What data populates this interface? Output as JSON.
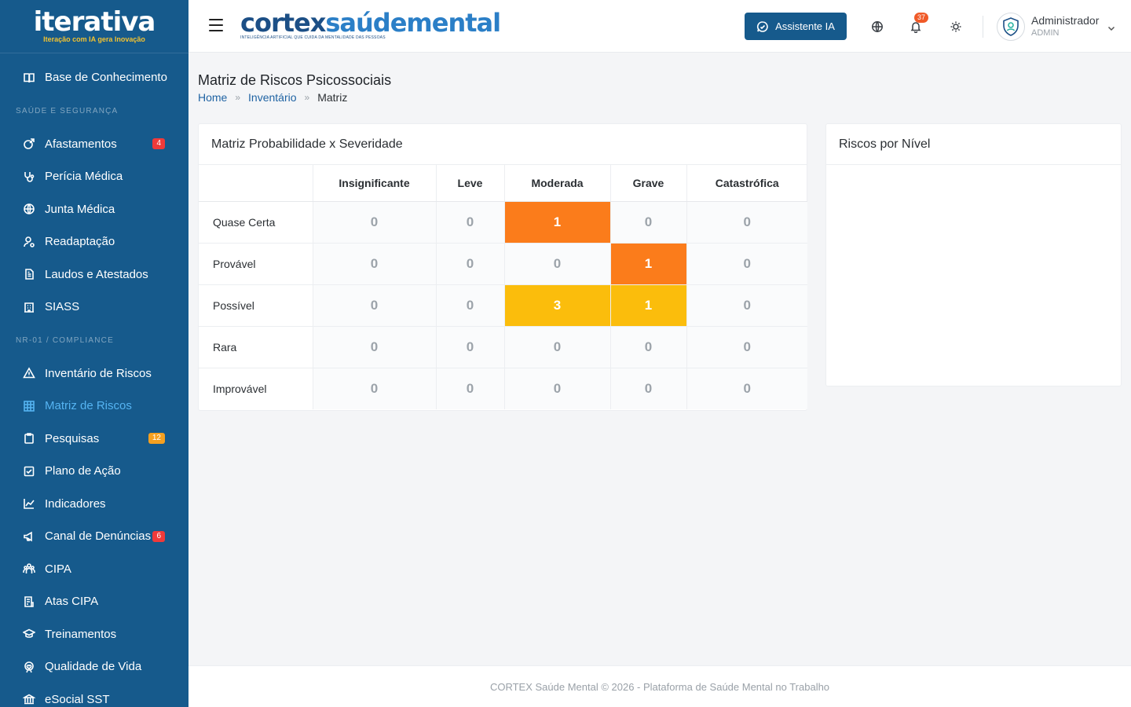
{
  "brand": {
    "name": "iterativa",
    "tagline": "Iteração com IA gera Inovação"
  },
  "header": {
    "logo_part1": "cortex",
    "logo_part2": "saúdemental",
    "logo_sub": "INTELIGÊNCIA ARTIFICIAL QUE CUIDA DA MENTALIDADE DAS PESSOAS",
    "ai_button": "Assistente IA",
    "notifications_count": "37",
    "user_name": "Administrador",
    "user_role": "ADMIN",
    "icons": {
      "menu": "hamburger-icon",
      "language": "globe-icon",
      "notifications": "bell-icon",
      "theme": "sun-icon"
    }
  },
  "sidebar": {
    "top_item": {
      "label": "Base de Conhecimento",
      "icon": "book-icon"
    },
    "section1": "SAÚDE E SEGURANÇA",
    "items1": [
      {
        "label": "Afastamentos",
        "icon": "leave-icon",
        "badge": "4",
        "badge_color": "#f03a3a"
      },
      {
        "label": "Perícia Médica",
        "icon": "stethoscope-icon"
      },
      {
        "label": "Junta Médica",
        "icon": "globe-icon"
      },
      {
        "label": "Readaptação",
        "icon": "user-cog-icon"
      },
      {
        "label": "Laudos e Atestados",
        "icon": "document-icon"
      },
      {
        "label": "SIASS",
        "icon": "building-icon"
      }
    ],
    "section2": "NR-01 / COMPLIANCE",
    "items2": [
      {
        "label": "Inventário de Riscos",
        "icon": "warning-icon"
      },
      {
        "label": "Matriz de Riscos",
        "icon": "grid-icon",
        "active": true
      },
      {
        "label": "Pesquisas",
        "icon": "clipboard-icon",
        "badge": "12",
        "badge_color": "#f5a020"
      },
      {
        "label": "Plano de Ação",
        "icon": "check-square-icon"
      },
      {
        "label": "Indicadores",
        "icon": "chart-line-icon"
      },
      {
        "label": "Canal de Denúncias",
        "icon": "megaphone-icon",
        "badge": "6",
        "badge_color": "#f03a3a"
      },
      {
        "label": "CIPA",
        "icon": "users-icon"
      },
      {
        "label": "Atas CIPA",
        "icon": "notes-icon"
      },
      {
        "label": "Treinamentos",
        "icon": "graduation-icon"
      },
      {
        "label": "Qualidade de Vida",
        "icon": "heart-icon"
      },
      {
        "label": "eSocial SST",
        "icon": "bank-icon"
      }
    ]
  },
  "page": {
    "title": "Matriz de Riscos Psicossociais",
    "breadcrumb": {
      "home": "Home",
      "inventory": "Inventário",
      "current": "Matriz",
      "separator": "»"
    }
  },
  "matrix": {
    "title": "Matriz Probabilidade x Severidade",
    "columns": [
      "Insignificante",
      "Leve",
      "Moderada",
      "Grave",
      "Catastrófica"
    ],
    "rows": [
      {
        "label": "Quase Certa",
        "values": [
          "0",
          "0",
          "1",
          "0",
          "0"
        ],
        "levels": [
          "",
          "",
          "hot-orange",
          "",
          ""
        ]
      },
      {
        "label": "Provável",
        "values": [
          "0",
          "0",
          "0",
          "1",
          "0"
        ],
        "levels": [
          "",
          "",
          "",
          "hot-orange",
          ""
        ]
      },
      {
        "label": "Possível",
        "values": [
          "0",
          "0",
          "3",
          "1",
          "0"
        ],
        "levels": [
          "",
          "",
          "hot-yellow",
          "hot-yellow",
          ""
        ]
      },
      {
        "label": "Rara",
        "values": [
          "0",
          "0",
          "0",
          "0",
          "0"
        ],
        "levels": [
          "",
          "",
          "",
          "",
          ""
        ]
      },
      {
        "label": "Improvável",
        "values": [
          "0",
          "0",
          "0",
          "0",
          "0"
        ],
        "levels": [
          "",
          "",
          "",
          "",
          ""
        ]
      }
    ],
    "colors": {
      "orange": "#fb7c1b",
      "yellow": "#fbbd0c"
    }
  },
  "risk_levels": {
    "title": "Riscos por Nível"
  },
  "footer": {
    "text": "CORTEX Saúde Mental © 2026 - Plataforma de Saúde Mental no Trabalho"
  }
}
